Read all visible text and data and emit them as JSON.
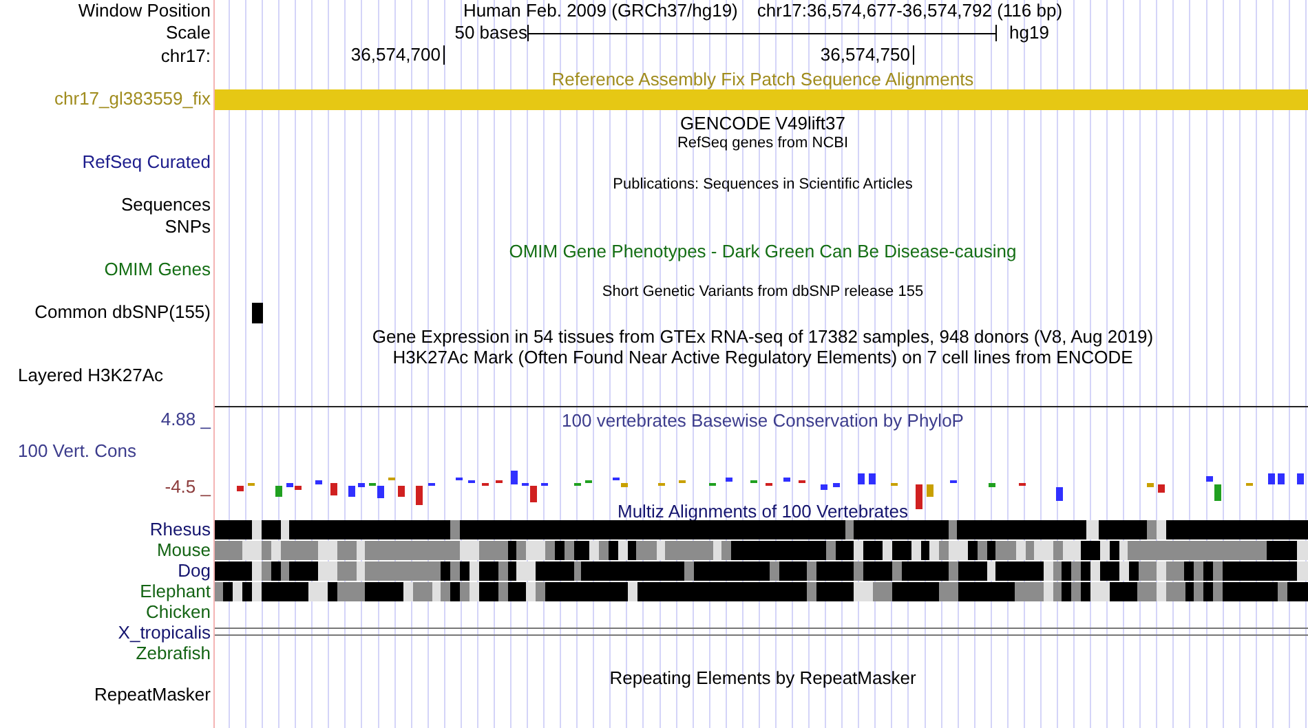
{
  "labels": [
    {
      "text": "Window Position",
      "color": "#000000"
    },
    {
      "text": "Scale",
      "color": "#000000"
    },
    {
      "text": "chr17:",
      "color": "#000000"
    },
    {
      "text": "chr17_gl383559_fix",
      "color": "#a08c1e"
    },
    {
      "text": "RefSeq Curated",
      "color": "#1c1c8c"
    },
    {
      "text": "Sequences",
      "color": "#000000"
    },
    {
      "text": "SNPs",
      "color": "#000000"
    },
    {
      "text": "OMIM Genes",
      "color": "#146e14"
    },
    {
      "text": "Common dbSNP(155)",
      "color": "#000000"
    },
    {
      "text": "Layered H3K27Ac",
      "color": "#000000"
    },
    {
      "text": "4.88 _",
      "color": "#3c3c8c"
    },
    {
      "text": "100 Vert. Cons",
      "color": "#3c3c8c"
    },
    {
      "text": "-4.5 _",
      "color": "#8c3c3c"
    },
    {
      "text": "Rhesus",
      "color": "#14146e"
    },
    {
      "text": "Mouse",
      "color": "#146414"
    },
    {
      "text": "Dog",
      "color": "#14146e"
    },
    {
      "text": "Elephant",
      "color": "#146414"
    },
    {
      "text": "Chicken",
      "color": "#146414"
    },
    {
      "text": "X_tropicalis",
      "color": "#14146e"
    },
    {
      "text": "Zebrafish",
      "color": "#146414"
    },
    {
      "text": "RepeatMasker",
      "color": "#000000"
    }
  ],
  "header": {
    "assembly": "Human Feb. 2009 (GRCh37/hg19)",
    "position": "chr17:36,574,677-36,574,792 (116 bp)"
  },
  "scale": {
    "text": "50 bases",
    "db": "hg19"
  },
  "ruler_ticks": [
    "36,574,700",
    "36,574,750"
  ],
  "track_titles": [
    {
      "text": "Reference Assembly Fix Patch Sequence Alignments",
      "color": "#a08c1e",
      "kind": "title"
    },
    {
      "text": "GENCODE V49lift37",
      "color": "#000000",
      "kind": "title"
    },
    {
      "text": "RefSeq genes from NCBI",
      "color": "#000000",
      "kind": "subtitle"
    },
    {
      "text": "Publications: Sequences in Scientific Articles",
      "color": "#000000",
      "kind": "subtitle"
    },
    {
      "text": "OMIM Gene Phenotypes - Dark Green Can Be Disease-causing",
      "color": "#146e14",
      "kind": "title"
    },
    {
      "text": "Short Genetic Variants from dbSNP release 155",
      "color": "#000000",
      "kind": "subtitle"
    },
    {
      "text": "Gene Expression in 54 tissues from GTEx RNA-seq of 17382 samples, 948 donors (V8, Aug 2019)",
      "color": "#000000",
      "kind": "title"
    },
    {
      "text": "H3K27Ac Mark (Often Found Near Active Regulatory Elements) on 7 cell lines from ENCODE",
      "color": "#000000",
      "kind": "title"
    },
    {
      "text": "100 vertebrates Basewise Conservation by PhyloP",
      "color": "#3c3c8c",
      "kind": "title"
    },
    {
      "text": "Multiz Alignments of 100 Vertebrates",
      "color": "#14146e",
      "kind": "title"
    },
    {
      "text": "Repeating Elements by RepeatMasker",
      "color": "#000000",
      "kind": "title"
    }
  ]
}
